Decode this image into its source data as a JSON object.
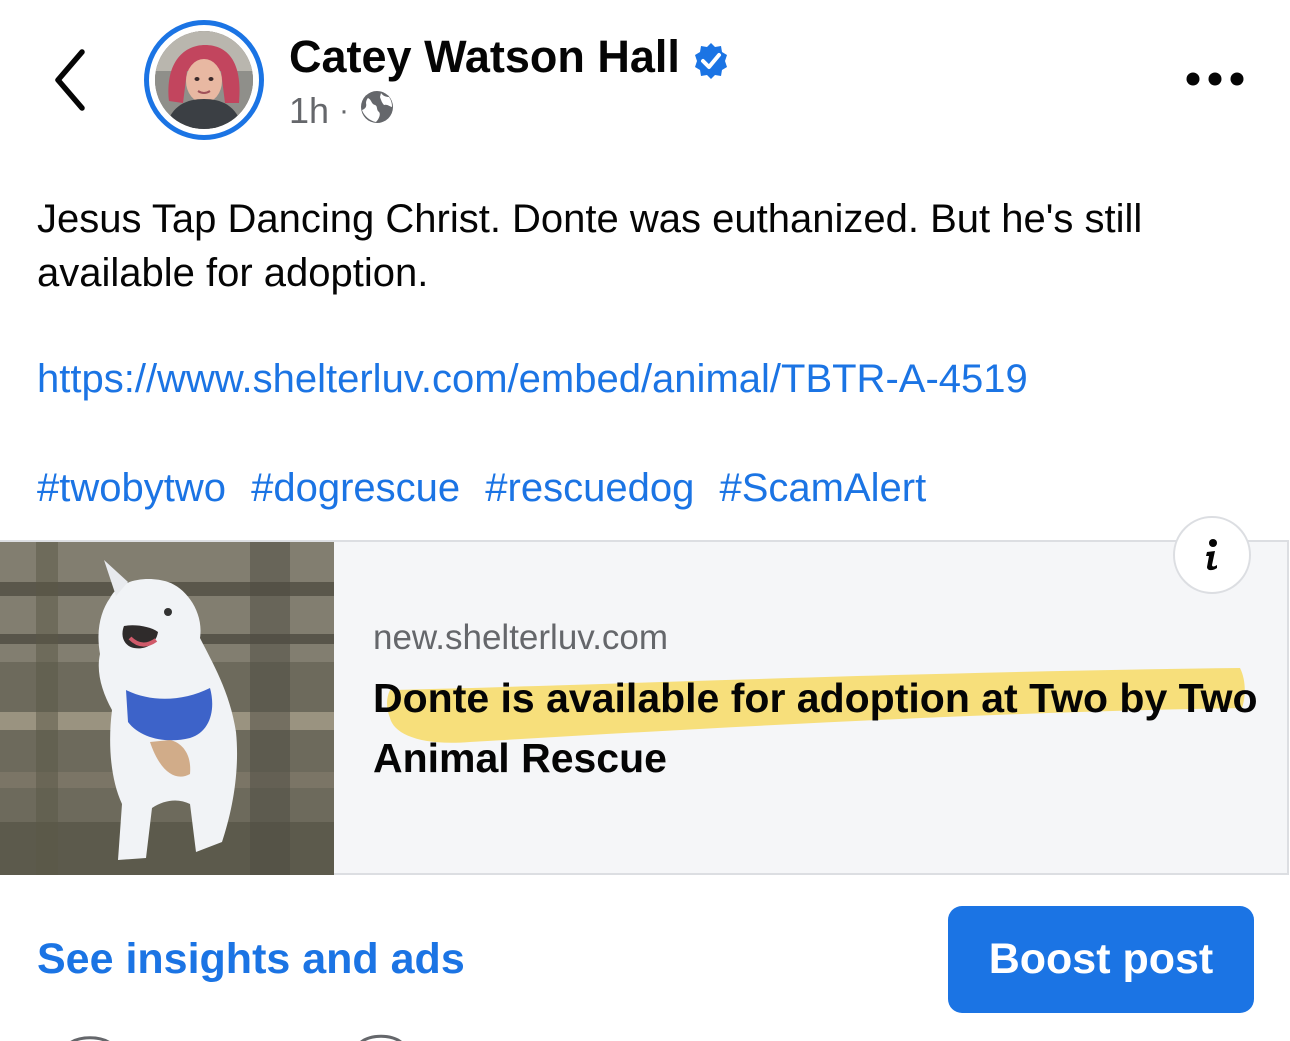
{
  "post": {
    "author": "Catey Watson Hall",
    "verified": true,
    "timestamp": "1h",
    "separator": "·",
    "audience_icon": "globe-icon",
    "text": "Jesus Tap Dancing Christ. Donte was euthanized. But he's still available for adoption.",
    "link": "https://www.shelterluv.com/embed/animal/TBTR-A-4519",
    "hashtags": [
      "#twobytwo",
      "#dogrescue",
      "#rescuedog",
      "#ScamAlert"
    ]
  },
  "preview": {
    "domain": "new.shelterluv.com",
    "title": "Donte is available for adoption at Two by Two Animal Rescue",
    "info_icon": "info-icon",
    "highlight_color": "#f7d752"
  },
  "actions": {
    "insights_label": "See insights and ads",
    "boost_label": "Boost post"
  },
  "colors": {
    "accent": "#1b74e4",
    "secondary_text": "#65676b",
    "card_bg": "#f5f6f8"
  }
}
